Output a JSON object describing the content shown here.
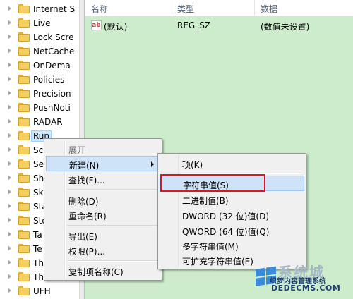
{
  "tree": {
    "items": [
      {
        "label": "Internet S"
      },
      {
        "label": "Live"
      },
      {
        "label": "Lock Scre"
      },
      {
        "label": "NetCache"
      },
      {
        "label": "OnDema"
      },
      {
        "label": "Policies"
      },
      {
        "label": "Precision"
      },
      {
        "label": "PushNoti"
      },
      {
        "label": "RADAR"
      },
      {
        "label": "Run"
      },
      {
        "label": "Sc"
      },
      {
        "label": "Se"
      },
      {
        "label": "Sh"
      },
      {
        "label": "Sk"
      },
      {
        "label": "Sta"
      },
      {
        "label": "Sto"
      },
      {
        "label": "Ta"
      },
      {
        "label": "Te"
      },
      {
        "label": "Th"
      },
      {
        "label": "Th"
      },
      {
        "label": "UFH"
      }
    ],
    "selected_index": 9
  },
  "list": {
    "headers": {
      "name": "名称",
      "type": "类型",
      "data": "数据"
    },
    "rows": [
      {
        "icon": "string-value-icon",
        "icon_text": "ab",
        "name": "(默认)",
        "type": "REG_SZ",
        "data": "(数值未设置)"
      }
    ],
    "background_color": "#cceccc"
  },
  "context_menu": {
    "items": [
      {
        "label": "展开",
        "disabled": true
      },
      {
        "label": "新建(N)",
        "submenu": true,
        "highlighted": true
      },
      {
        "label": "查找(F)..."
      },
      {
        "label": "删除(D)"
      },
      {
        "label": "重命名(R)"
      },
      {
        "label": "导出(E)"
      },
      {
        "label": "权限(P)..."
      },
      {
        "label": "复制项名称(C)"
      }
    ]
  },
  "submenu": {
    "items": [
      {
        "label": "项(K)"
      },
      {
        "label": "字符串值(S)",
        "highlighted": true,
        "red_outline": true
      },
      {
        "label": "二进制值(B)"
      },
      {
        "label": "DWORD (32 位)值(D)"
      },
      {
        "label": "QWORD (64 位)值(Q)"
      },
      {
        "label": "多字符串值(M)"
      },
      {
        "label": "可扩充字符串值(E)"
      }
    ]
  },
  "watermark": {
    "brand": "系统城",
    "line1": "织梦内容管理系统",
    "line2": "DEDECMS.COM"
  },
  "colors": {
    "highlight": "#cfe3f8",
    "red_outline": "#e0141e",
    "menu_bg": "#f0f0f0"
  }
}
